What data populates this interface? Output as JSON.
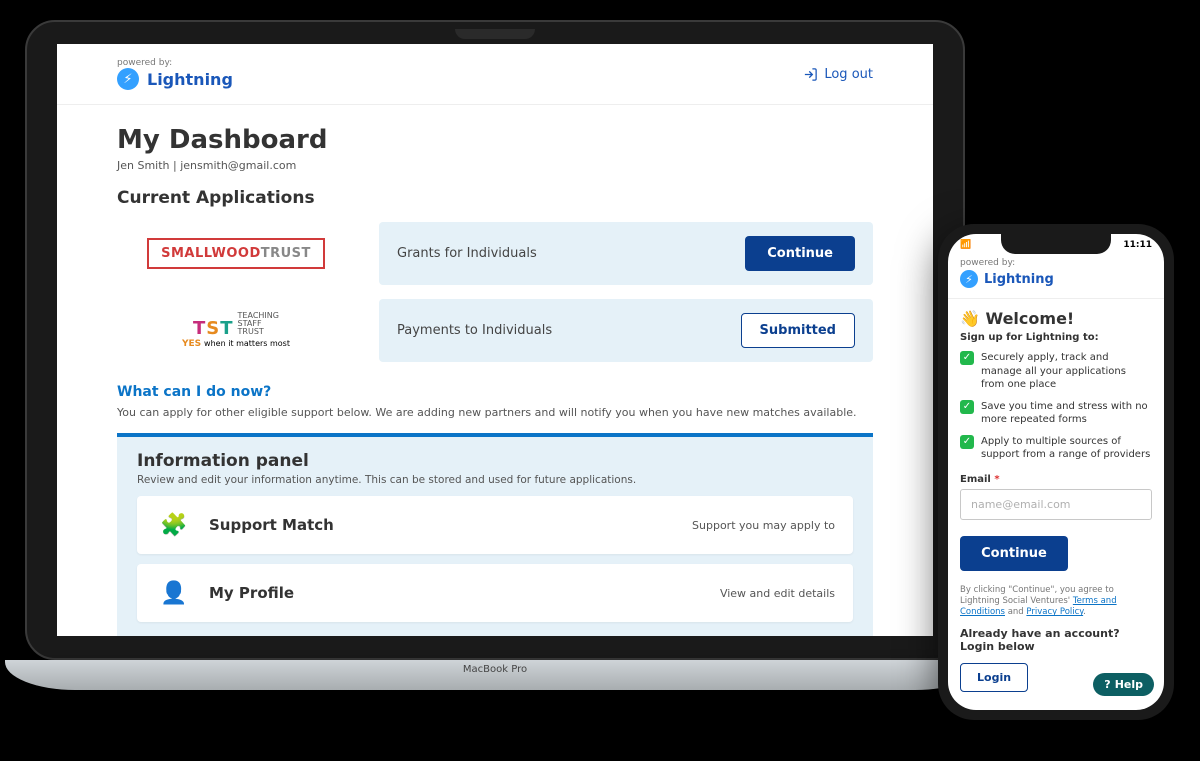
{
  "desktop": {
    "powered": "powered by:",
    "brand": "Lightning",
    "logout": "Log out",
    "title": "My Dashboard",
    "user": "Jen Smith | jensmith@gmail.com",
    "apps_heading": "Current Applications",
    "apps": [
      {
        "name": "Grants for Individuals",
        "action": "Continue",
        "style": "primary",
        "logo": "smallwood"
      },
      {
        "name": "Payments to Individuals",
        "action": "Submitted",
        "style": "outline",
        "logo": "tst"
      }
    ],
    "what_now": "What can I do now?",
    "what_now_desc": "You can apply for other eligible support below. We are adding new partners and will notify you when you have new matches available.",
    "info": {
      "title": "Information panel",
      "desc": "Review and edit your information anytime. This can be stored and used for future applications.",
      "tiles": [
        {
          "title": "Support Match",
          "action": "Support you may apply to"
        },
        {
          "title": "My Profile",
          "action": "View and edit details"
        }
      ]
    },
    "base": "MacBook Pro"
  },
  "mobile": {
    "time": "11:11",
    "powered": "powered by:",
    "brand": "Lightning",
    "welcome": "Welcome!",
    "sub": "Sign up for Lightning to:",
    "bullets": [
      "Securely apply, track and manage all your applications from one place",
      "Save you time and stress with no more repeated forms",
      "Apply to multiple sources of support from a range of providers"
    ],
    "email_label": "Email",
    "email_placeholder": "name@email.com",
    "continue": "Continue",
    "legal_pre": "By clicking \"Continue\", you agree to Lightning Social Ventures' ",
    "legal_tc": "Terms and Conditions",
    "legal_and": " and ",
    "legal_pp": "Privacy Policy",
    "already": "Already have an account? Login below",
    "login": "Login",
    "help": "Help"
  }
}
